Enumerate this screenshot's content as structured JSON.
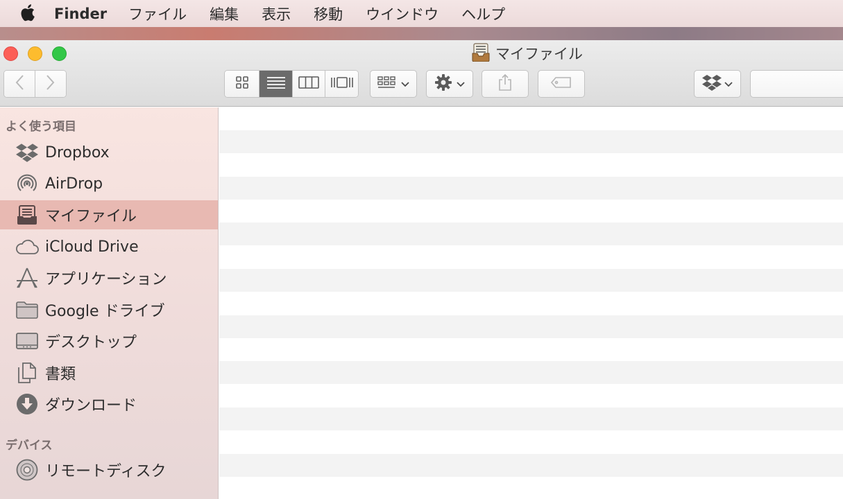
{
  "menubar": {
    "apple_icon": "apple-icon",
    "app_name": "Finder",
    "items": [
      "ファイル",
      "編集",
      "表示",
      "移動",
      "ウインドウ",
      "ヘルプ"
    ]
  },
  "window": {
    "title": "マイファイル",
    "title_icon": "all-my-files-icon"
  },
  "toolbar": {
    "back_icon": "chevron-left-icon",
    "forward_icon": "chevron-right-icon",
    "view_modes": [
      "icon-view",
      "list-view",
      "column-view",
      "cover-flow-view"
    ],
    "active_view": "list-view",
    "arrange_icon": "arrange-grid-icon",
    "action_icon": "gear-icon",
    "share_icon": "share-icon",
    "tag_icon": "tag-icon",
    "dropbox_icon": "dropbox-icon",
    "search_placeholder": ""
  },
  "sidebar": {
    "favorites_header": "よく使う項目",
    "favorites": [
      {
        "label": "Dropbox",
        "icon": "dropbox-icon"
      },
      {
        "label": "AirDrop",
        "icon": "airdrop-icon"
      },
      {
        "label": "マイファイル",
        "icon": "all-my-files-icon",
        "selected": true
      },
      {
        "label": "iCloud Drive",
        "icon": "cloud-icon"
      },
      {
        "label": "アプリケーション",
        "icon": "applications-icon"
      },
      {
        "label": "Google ドライブ",
        "icon": "folder-icon"
      },
      {
        "label": "デスクトップ",
        "icon": "desktop-icon"
      },
      {
        "label": "書類",
        "icon": "documents-icon"
      },
      {
        "label": "ダウンロード",
        "icon": "download-icon"
      }
    ],
    "devices_header": "デバイス",
    "devices": [
      {
        "label": "リモートディスク",
        "icon": "disc-icon"
      }
    ]
  },
  "colors": {
    "selection": "#e8b9b2",
    "sidebar_bg": "#f4e0dd",
    "row_alt": "#f3f3f3"
  }
}
